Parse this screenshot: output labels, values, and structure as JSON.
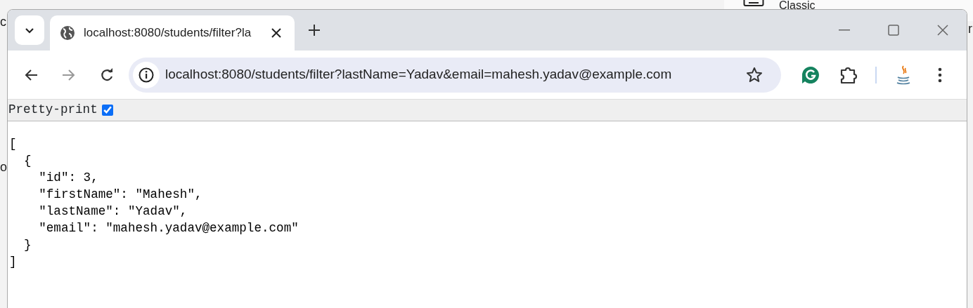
{
  "background": {
    "label": "Classic",
    "fragments": [
      "c",
      "o",
      "r"
    ]
  },
  "tabs": [
    {
      "title": "localhost:8080/students/filter?la",
      "selected": true
    }
  ],
  "address_bar": {
    "url": "localhost:8080/students/filter?lastName=Yadav&email=mahesh.yadav@example.com"
  },
  "pretty_print": {
    "label": "Pretty-print",
    "checked": true
  },
  "json_lines": [
    "[",
    "  {",
    "    \"id\": 3,",
    "    \"firstName\": \"Mahesh\",",
    "    \"lastName\": \"Yadav\",",
    "    \"email\": \"mahesh.yadav@example.com\"",
    "  }",
    "]"
  ]
}
